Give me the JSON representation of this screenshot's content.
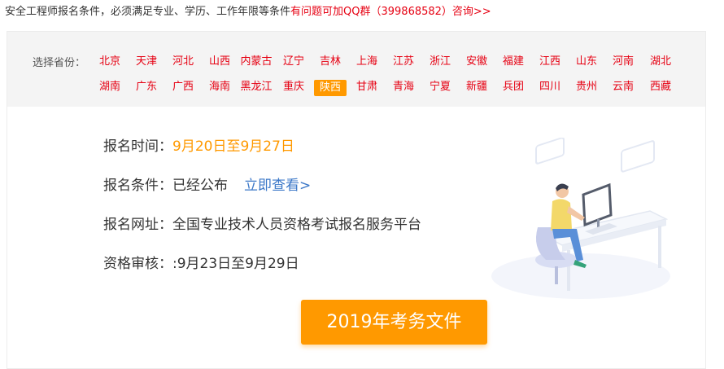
{
  "notice": {
    "text_black": "安全工程师报名条件，必须满足专业、学历、工作年限等条件",
    "text_red": "有问题可加QQ群（399868582）咨询>>"
  },
  "province_selector": {
    "label": "选择省份：",
    "active": "陕西",
    "row1": [
      "北京",
      "天津",
      "河北",
      "山西",
      "内蒙古",
      "辽宁",
      "吉林",
      "上海",
      "江苏",
      "浙江",
      "安徽",
      "福建",
      "江西",
      "山东",
      "河南",
      "湖北"
    ],
    "row2": [
      "湖南",
      "广东",
      "广西",
      "海南",
      "黑龙江",
      "重庆",
      "陕西",
      "甘肃",
      "青海",
      "宁夏",
      "新疆",
      "兵团",
      "四川",
      "贵州",
      "云南",
      "西藏"
    ]
  },
  "info": {
    "reg_time_label": "报名时间：",
    "reg_time_value": "9月20日至9月27日",
    "reg_cond_label": "报名条件：",
    "reg_cond_value": "已经公布",
    "reg_cond_link": "立即查看>",
    "reg_site_label": "报名网址：",
    "reg_site_value": "全国专业技术人员资格考试报名服务平台",
    "review_label": "资格审核：",
    "review_value": ":9月23日至9月29日"
  },
  "button": {
    "label": "2019年考务文件"
  },
  "colors": {
    "red": "#e60012",
    "orange": "#ff9900",
    "link": "#3c78c8",
    "bar": "#f4f4f4"
  }
}
